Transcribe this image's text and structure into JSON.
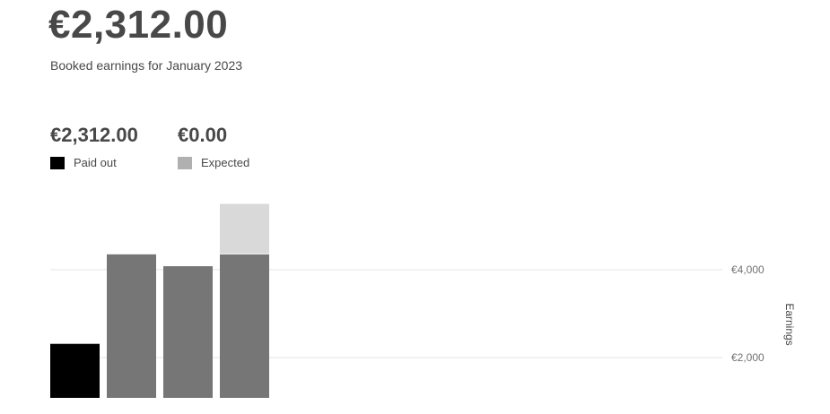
{
  "header": {
    "total_amount": "€2,312.00",
    "subtitle": "Booked earnings for January 2023"
  },
  "summary": {
    "paid_out": {
      "amount": "€2,312.00",
      "label": "Paid out",
      "color": "#000000"
    },
    "expected": {
      "amount": "€0.00",
      "label": "Expected",
      "color": "#b0b0b0"
    }
  },
  "chart_data": {
    "type": "bar",
    "stacked": true,
    "categories": [
      "",
      "",
      "",
      ""
    ],
    "series": [
      {
        "name": "Paid out",
        "color_current": "#000000",
        "color_past": "#767676",
        "values": [
          2312,
          4350,
          4080,
          4350
        ]
      },
      {
        "name": "Expected",
        "color": "#d9d9d9",
        "values": [
          0,
          0,
          0,
          1150
        ]
      }
    ],
    "highlight_index": 0,
    "yticks": [
      {
        "value": 4000,
        "label": "€4,000"
      },
      {
        "value": 2000,
        "label": "€2,000"
      }
    ],
    "ylabel": "Earnings",
    "grid": true
  }
}
